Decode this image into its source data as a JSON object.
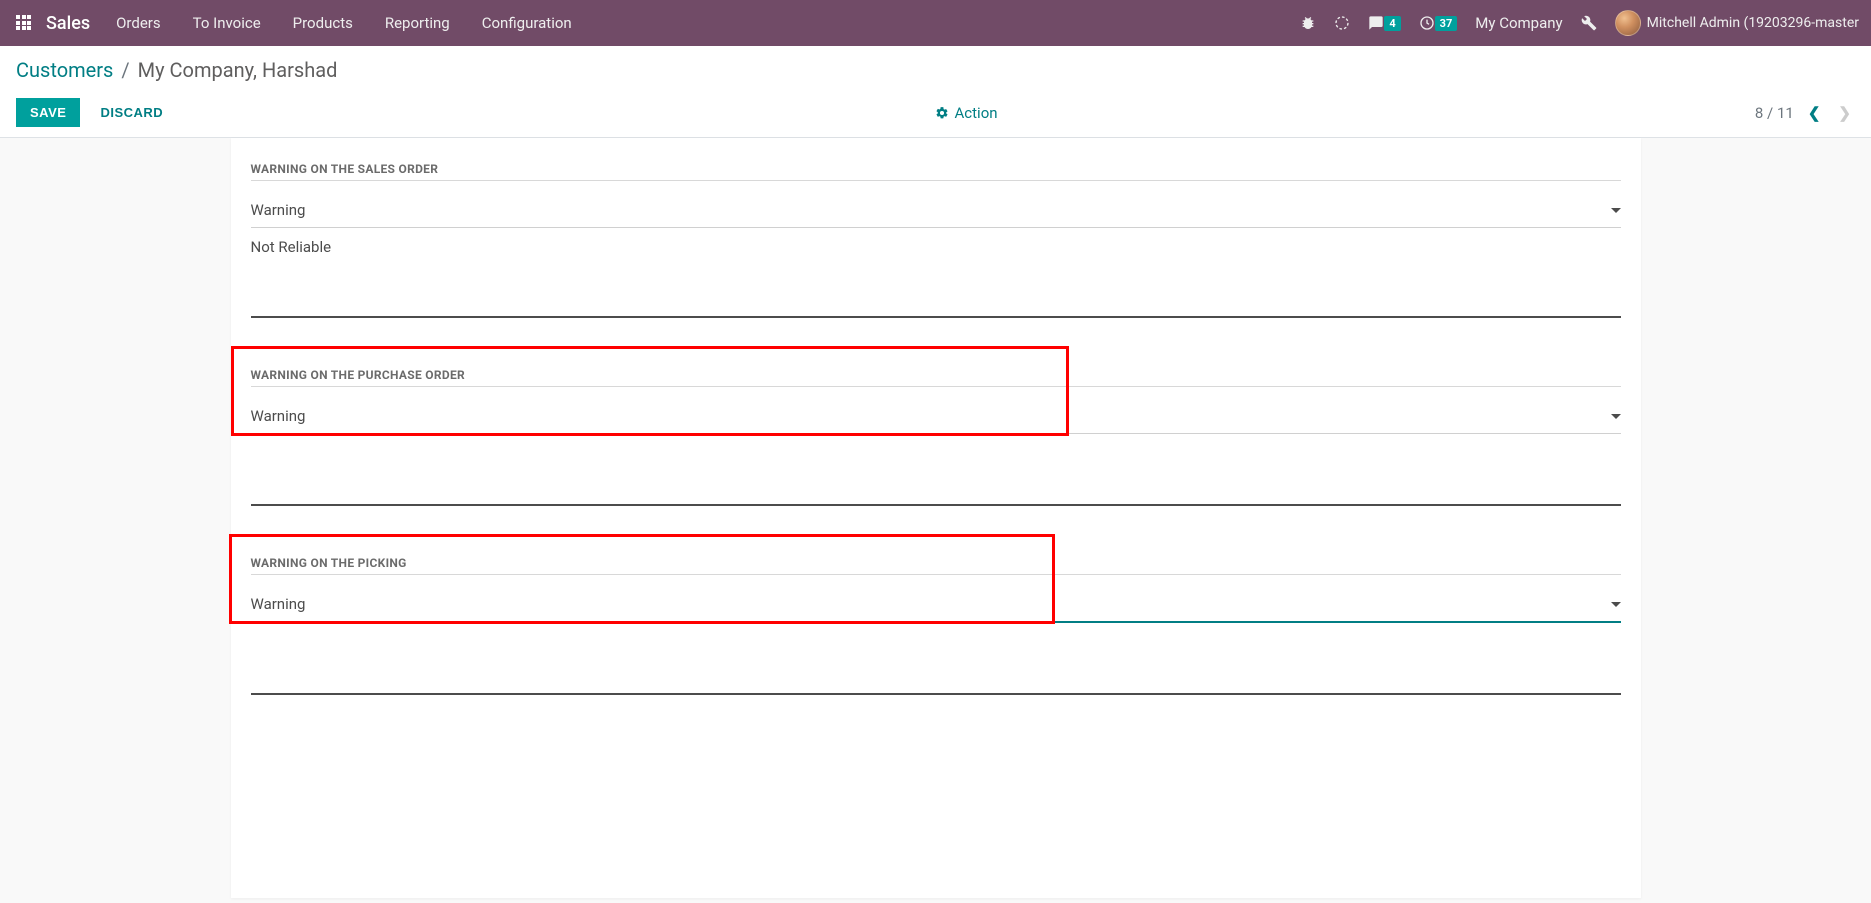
{
  "navbar": {
    "brand": "Sales",
    "menu": [
      "Orders",
      "To Invoice",
      "Products",
      "Reporting",
      "Configuration"
    ],
    "messages_badge": "4",
    "activities_badge": "37",
    "company": "My Company",
    "user": "Mitchell Admin (19203296-master"
  },
  "breadcrumb": {
    "parent": "Customers",
    "current": "My Company, Harshad"
  },
  "buttons": {
    "save": "SAVE",
    "discard": "DISCARD",
    "action": "Action"
  },
  "pager": {
    "current": "8",
    "total": "11",
    "sep": "/"
  },
  "sections": {
    "sales_order": {
      "title": "WARNING ON THE SALES ORDER",
      "select_value": "Warning",
      "message": "Not Reliable"
    },
    "purchase_order": {
      "title": "WARNING ON THE PURCHASE ORDER",
      "select_value": "Warning"
    },
    "picking": {
      "title": "WARNING ON THE PICKING",
      "select_value": "Warning"
    }
  }
}
